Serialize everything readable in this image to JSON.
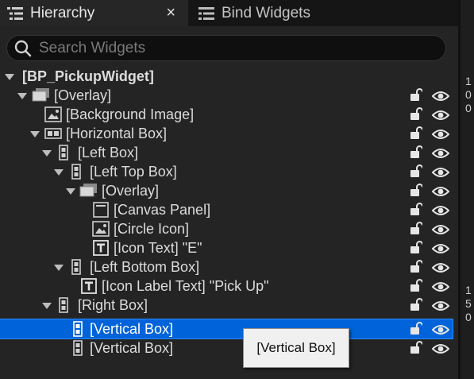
{
  "tabs": [
    {
      "label": "Hierarchy",
      "icon": "hierarchy-icon",
      "active": true
    },
    {
      "label": "Bind Widgets",
      "icon": "bind-widgets-icon",
      "active": false
    }
  ],
  "tab_close_glyph": "×",
  "search": {
    "placeholder": "Search Widgets",
    "value": ""
  },
  "tree": [
    {
      "label": "[BP_PickupWidget]",
      "icon": null,
      "expanded": true,
      "bold": true
    },
    {
      "label": "[Overlay]",
      "icon": "overlay-icon",
      "expanded": true
    },
    {
      "label": "[Background Image]",
      "icon": "image-icon",
      "expanded": null
    },
    {
      "label": "[Horizontal Box]",
      "icon": "horizontal-box-icon",
      "expanded": true
    },
    {
      "label": "[Left Box]",
      "icon": "vertical-box-icon",
      "expanded": true
    },
    {
      "label": "[Left Top Box]",
      "icon": "vertical-box-icon",
      "expanded": true
    },
    {
      "label": "[Overlay]",
      "icon": "overlay-icon",
      "expanded": true
    },
    {
      "label": "[Canvas Panel]",
      "icon": "canvas-panel-icon",
      "expanded": null
    },
    {
      "label": "[Circle Icon]",
      "icon": "image-icon",
      "expanded": null
    },
    {
      "label": "[Icon Text] \"E\"",
      "icon": "text-icon",
      "expanded": null
    },
    {
      "label": "[Left Bottom Box]",
      "icon": "vertical-box-icon",
      "expanded": true
    },
    {
      "label": "[Icon Label Text] \"Pick Up\"",
      "icon": "text-icon",
      "expanded": null
    },
    {
      "label": "[Right Box]",
      "icon": "vertical-box-icon",
      "expanded": true
    },
    {
      "label": "[Vertical Box]",
      "icon": "vertical-box-icon",
      "expanded": null,
      "selected": true
    },
    {
      "label": "[Vertical Box]",
      "icon": "vertical-box-icon",
      "expanded": null
    }
  ],
  "tooltip": "[Vertical Box]",
  "right_strip": [
    "1",
    "0",
    "0",
    "1",
    "5",
    "0"
  ],
  "colors": {
    "selection": "#0063d9",
    "panel": "#242424",
    "text": "#dcdcdc"
  }
}
